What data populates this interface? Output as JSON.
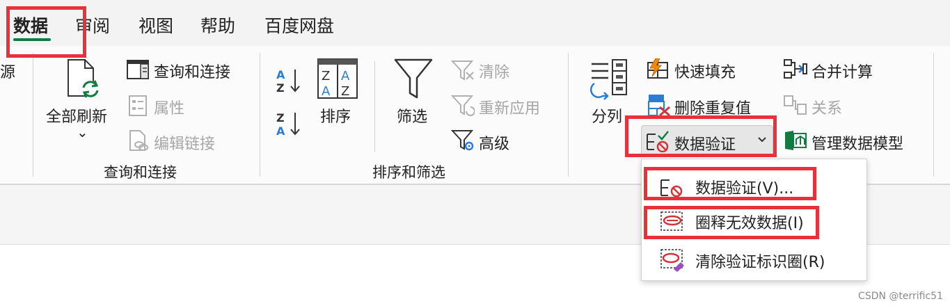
{
  "tabs": [
    "数据",
    "审阅",
    "视图",
    "帮助",
    "百度网盘"
  ],
  "ribbon": {
    "partial_left": "源",
    "query_group": {
      "refresh_all": "全部刷新",
      "refresh_chevron": "⌄",
      "queries_connections": "查询和连接",
      "properties": "属性",
      "edit_links": "编辑链接",
      "group_label": "查询和连接"
    },
    "sort_group": {
      "sort": "排序",
      "filter": "筛选",
      "clear": "清除",
      "reapply": "重新应用",
      "advanced": "高级",
      "group_label": "排序和筛选"
    },
    "data_tools_group": {
      "text_to_columns": "分列",
      "flash_fill": "快速填充",
      "remove_duplicates": "删除重复值",
      "data_validation": "数据验证",
      "consolidate": "合并计算",
      "relationships": "关系",
      "manage_data_model": "管理数据模型"
    }
  },
  "dropdown": {
    "items": [
      {
        "label": "数据验证(V)..."
      },
      {
        "label": "圈释无效数据(I)"
      },
      {
        "label": "清除验证标识圈(R)"
      }
    ]
  },
  "watermark": "CSDN @terrific51",
  "colors": {
    "accent_green": "#107c41",
    "highlight_red": "#e8313b",
    "icon_blue": "#2b7cd3",
    "icon_red": "#d13438"
  }
}
